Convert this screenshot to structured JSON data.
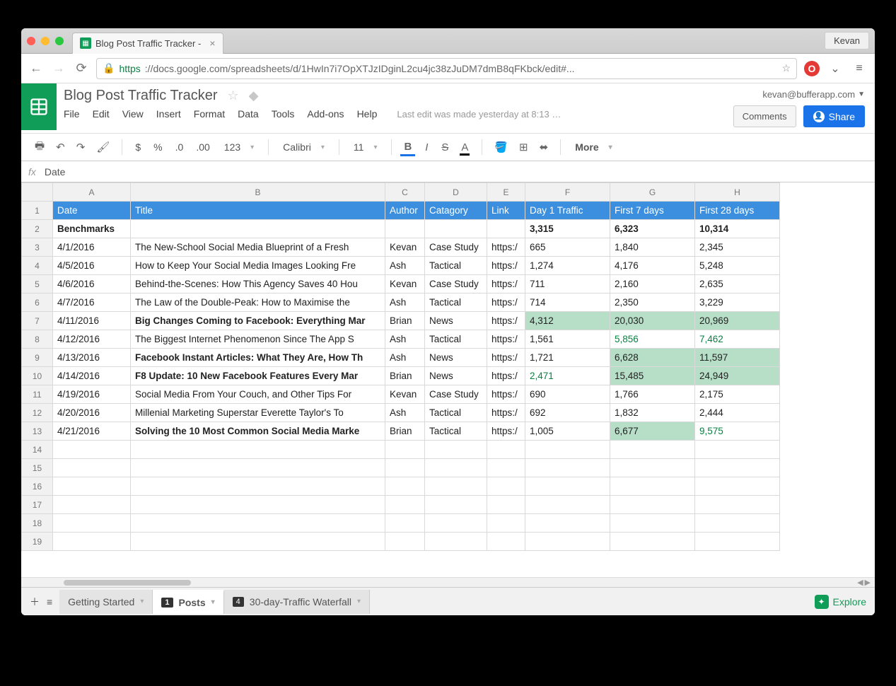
{
  "chrome": {
    "tab_title": "Blog Post Traffic Tracker - ",
    "profile": "Kevan",
    "url_prefix": "https",
    "url_rest": "://docs.google.com/spreadsheets/d/1HwIn7i7OpXTJzIDginL2cu4jc38zJuDM7dmB8qFKbck/edit#..."
  },
  "doc": {
    "title": "Blog Post Traffic Tracker",
    "account": "kevan@bufferapp.com",
    "comments_btn": "Comments",
    "share_btn": "Share",
    "menus": [
      "File",
      "Edit",
      "View",
      "Insert",
      "Format",
      "Data",
      "Tools",
      "Add-ons",
      "Help"
    ],
    "last_edit": "Last edit was made yesterday at 8:13 …"
  },
  "toolbar": {
    "font": "Calibri",
    "size": "11",
    "more": "More"
  },
  "formula_bar": "Date",
  "columns": [
    "A",
    "B",
    "C",
    "D",
    "E",
    "F",
    "G",
    "H"
  ],
  "headers": {
    "A": "Date",
    "B": "Title",
    "C": "Author",
    "D": "Catagory",
    "E": "Link",
    "F": "Day 1 Traffic",
    "G": "First 7 days",
    "H": "First 28 days"
  },
  "benchmarks": {
    "label": "Benchmarks",
    "F": "3,315",
    "G": "6,323",
    "H": "10,314"
  },
  "rows": [
    {
      "date": "4/1/2016",
      "title": "The New-School Social Media Blueprint of a Fresh",
      "author": "Kevan",
      "cat": "Case Study",
      "link": "https:/",
      "f": "665",
      "g": "1,840",
      "h": "2,345",
      "bold": false,
      "hl": {}
    },
    {
      "date": "4/5/2016",
      "title": "How to Keep Your Social Media Images Looking Fre",
      "author": "Ash",
      "cat": "Tactical",
      "link": "https:/",
      "f": "1,274",
      "g": "4,176",
      "h": "5,248",
      "bold": false,
      "hl": {}
    },
    {
      "date": "4/6/2016",
      "title": "Behind-the-Scenes: How This Agency Saves 40 Hou",
      "author": "Kevan",
      "cat": "Case Study",
      "link": "https:/",
      "f": "711",
      "g": "2,160",
      "h": "2,635",
      "bold": false,
      "hl": {}
    },
    {
      "date": "4/7/2016",
      "title": "The Law of the Double-Peak: How to Maximise the",
      "author": "Ash",
      "cat": "Tactical",
      "link": "https:/",
      "f": "714",
      "g": "2,350",
      "h": "3,229",
      "bold": false,
      "hl": {}
    },
    {
      "date": "4/11/2016",
      "title": "Big Changes Coming to Facebook: Everything Mar",
      "author": "Brian",
      "cat": "News",
      "link": "https:/",
      "f": "4,312",
      "g": "20,030",
      "h": "20,969",
      "bold": true,
      "hl": {
        "f": "fill",
        "g": "fill",
        "h": "fill"
      }
    },
    {
      "date": "4/12/2016",
      "title": "The Biggest Internet Phenomenon Since The App S",
      "author": "Ash",
      "cat": "Tactical",
      "link": "https:/",
      "f": "1,561",
      "g": "5,856",
      "h": "7,462",
      "bold": false,
      "hl": {
        "g": "txt",
        "h": "txt"
      }
    },
    {
      "date": "4/13/2016",
      "title": "Facebook Instant Articles: What They Are, How Th",
      "author": "Ash",
      "cat": "News",
      "link": "https:/",
      "f": "1,721",
      "g": "6,628",
      "h": "11,597",
      "bold": true,
      "hl": {
        "g": "fill",
        "h": "fill"
      }
    },
    {
      "date": "4/14/2016",
      "title": "F8 Update: 10 New Facebook Features Every Mar",
      "author": "Brian",
      "cat": "News",
      "link": "https:/",
      "f": "2,471",
      "g": "15,485",
      "h": "24,949",
      "bold": true,
      "hl": {
        "f": "txt",
        "g": "fill",
        "h": "fill"
      }
    },
    {
      "date": "4/19/2016",
      "title": "Social Media From Your Couch, and Other Tips For",
      "author": "Kevan",
      "cat": "Case Study",
      "link": "https:/",
      "f": "690",
      "g": "1,766",
      "h": "2,175",
      "bold": false,
      "hl": {}
    },
    {
      "date": "4/20/2016",
      "title": "Millenial Marketing Superstar Everette Taylor's To",
      "author": "Ash",
      "cat": "Tactical",
      "link": "https:/",
      "f": "692",
      "g": "1,832",
      "h": "2,444",
      "bold": false,
      "hl": {}
    },
    {
      "date": "4/21/2016",
      "title": "Solving the 10 Most Common Social Media Marke",
      "author": "Brian",
      "cat": "Tactical",
      "link": "https:/",
      "f": "1,005",
      "g": "6,677",
      "h": "9,575",
      "bold": true,
      "hl": {
        "g": "fill",
        "h": "txt"
      }
    }
  ],
  "empty_rows": [
    14,
    15,
    16,
    17,
    18,
    19
  ],
  "sheets": {
    "tabs": [
      {
        "label": "Getting Started",
        "badge": null,
        "active": false
      },
      {
        "label": "Posts",
        "badge": "1",
        "active": true
      },
      {
        "label": "30-day-Traffic Waterfall",
        "badge": "4",
        "active": false
      }
    ],
    "explore": "Explore"
  }
}
